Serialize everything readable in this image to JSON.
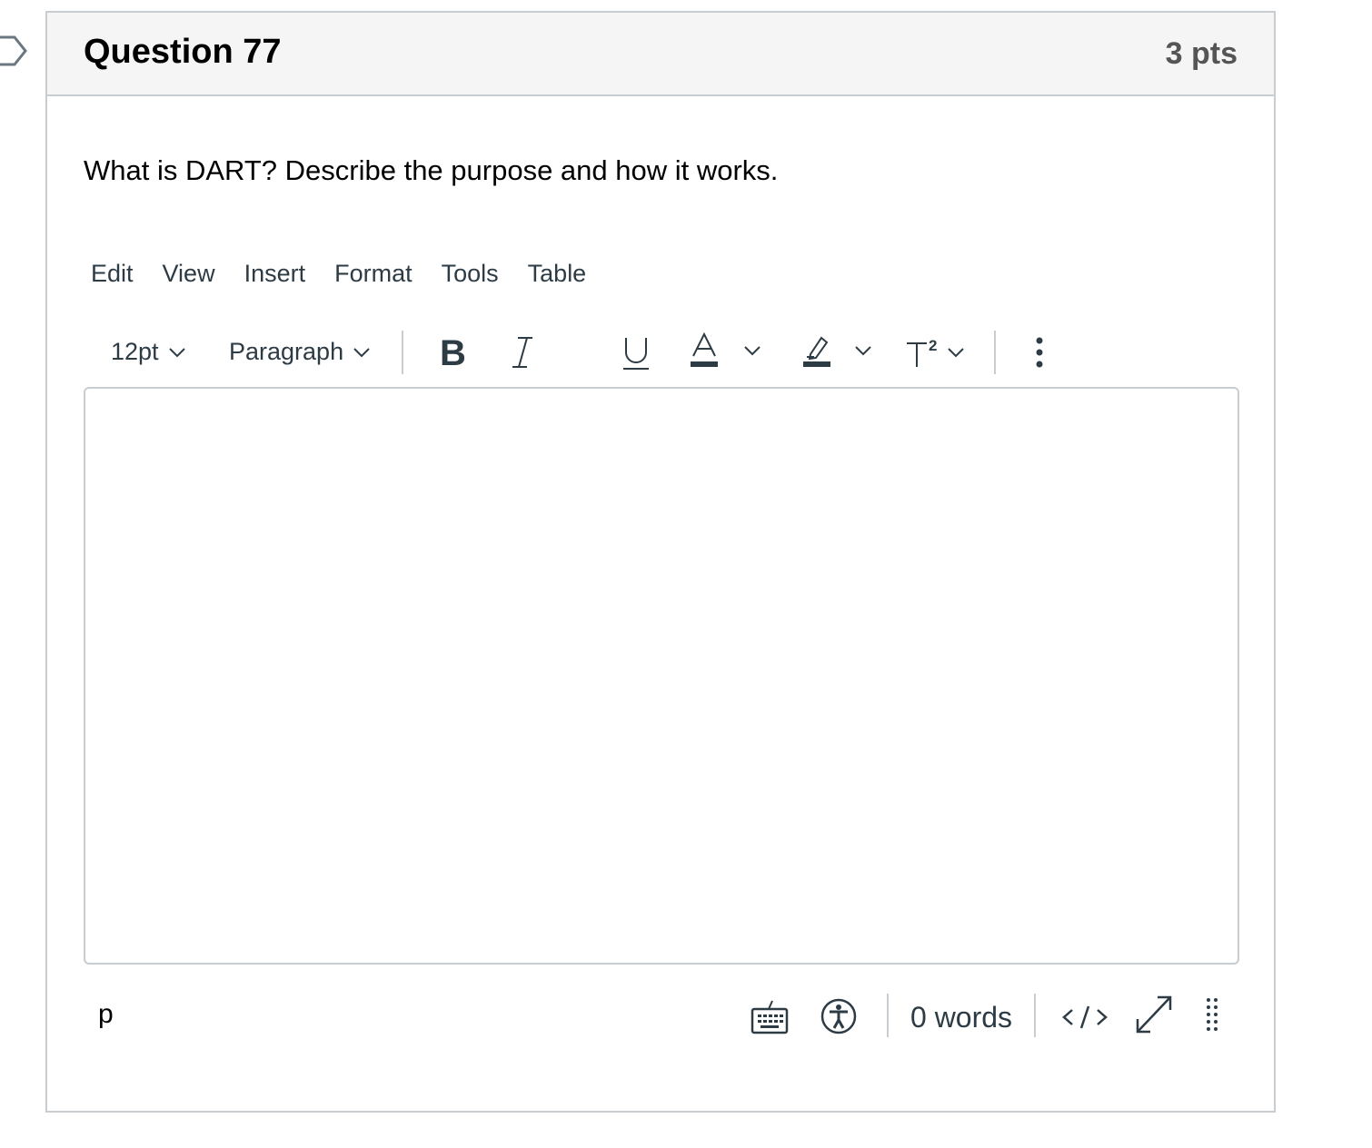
{
  "question": {
    "title": "Question 77",
    "points": "3 pts",
    "text": "What is DART? Describe the purpose and how it works."
  },
  "editor": {
    "menu": [
      "Edit",
      "View",
      "Insert",
      "Format",
      "Tools",
      "Table"
    ],
    "toolbar": {
      "font_size": "12pt",
      "block_format": "Paragraph",
      "buttons": [
        "bold-icon",
        "italic-icon",
        "underline-icon",
        "text-color-icon",
        "highlight-icon",
        "superscript-icon",
        "more-icon"
      ]
    },
    "content": "",
    "statusbar": {
      "path": "p",
      "word_count": "0 words",
      "icons": [
        "keyboard-icon",
        "accessibility-icon",
        "html-source-icon",
        "fullscreen-icon",
        "resize-handle-icon"
      ]
    }
  },
  "colors": {
    "text": "#2d3b45",
    "border": "#c7cdd1",
    "header_bg": "#f5f5f5"
  }
}
